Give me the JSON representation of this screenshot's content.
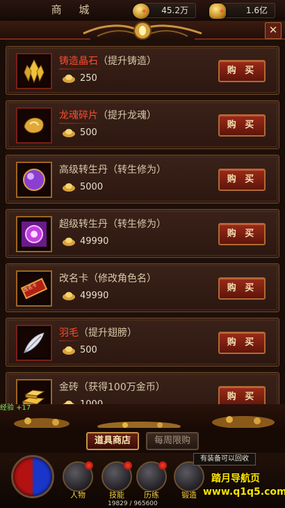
{
  "header": {
    "title": "商 城",
    "currency_1": "45.2万",
    "currency_2": "1.6亿"
  },
  "items": [
    {
      "name_main": "铸造晶石",
      "name_note": "（提升铸造）",
      "price": "250",
      "buy": "购 买",
      "highlight": true
    },
    {
      "name_main": "龙魂碎片",
      "name_note": "（提升龙魂）",
      "price": "500",
      "buy": "购 买",
      "highlight": true
    },
    {
      "name_main": "高级转生丹",
      "name_note": "（转生修为）",
      "price": "5000",
      "buy": "购 买",
      "highlight": false
    },
    {
      "name_main": "超级转生丹",
      "name_note": "（转生修为）",
      "price": "49990",
      "buy": "购 买",
      "highlight": false
    },
    {
      "name_main": "改名卡",
      "name_note": "（修改角色名）",
      "price": "49990",
      "buy": "购 买",
      "highlight": false
    },
    {
      "name_main": "羽毛",
      "name_note": "（提升翅膀）",
      "price": "500",
      "buy": "购 买",
      "highlight": true
    },
    {
      "name_main": "金砖",
      "name_note": "（获得100万金币）",
      "price": "1000",
      "buy": "购 买",
      "highlight": false
    }
  ],
  "rename_card_text": "改名卡",
  "exp_gain": "经验 +17",
  "tabs": {
    "active": "道具商店",
    "inactive": "每周限购"
  },
  "hud": {
    "tooltip": "有装备可以回收",
    "nav": [
      "人物",
      "技能",
      "历练",
      "锻造"
    ],
    "hp": "19829 / 965600",
    "watermark_line1": "踏月导航页",
    "watermark_line2": "www.q1q5.com"
  }
}
